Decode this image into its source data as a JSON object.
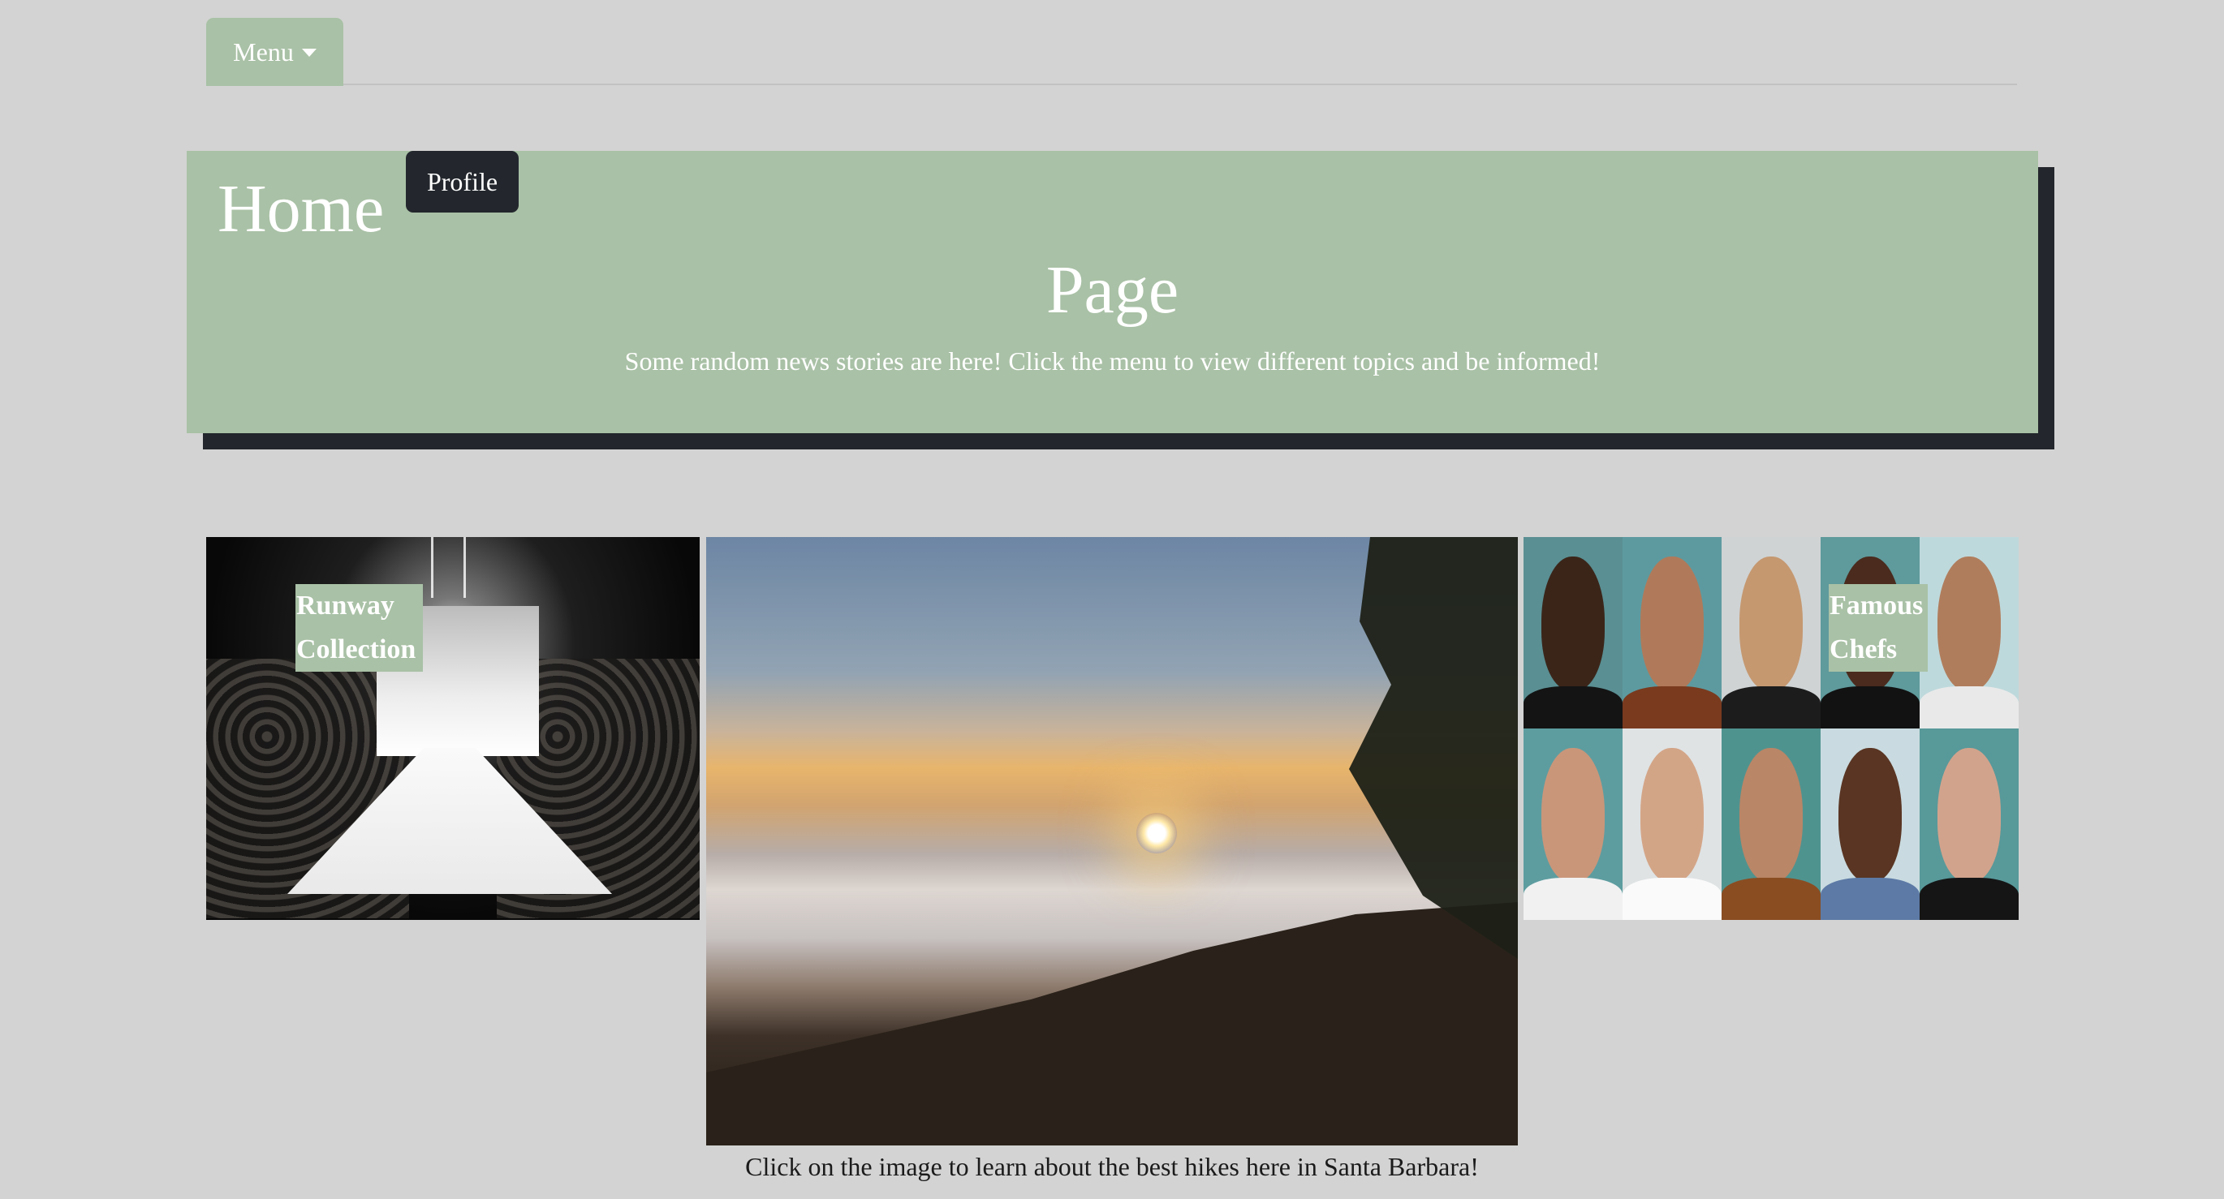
{
  "nav": {
    "menu_label": "Menu"
  },
  "hero": {
    "title_line1": "Home",
    "title_line2": "Page",
    "subtitle": "Some random news stories are here! Click the menu to view different topics and be informed!",
    "profile_label": "Profile"
  },
  "cards": {
    "runway_label": "Runway Collection",
    "chefs_label": "Famous Chefs",
    "hikes_caption": "Click on the image to learn about the best hikes here in Santa Barbara!"
  },
  "colors": {
    "background": "#d3d3d3",
    "accent_green": "#a9c1a6",
    "dark": "#23272d"
  }
}
